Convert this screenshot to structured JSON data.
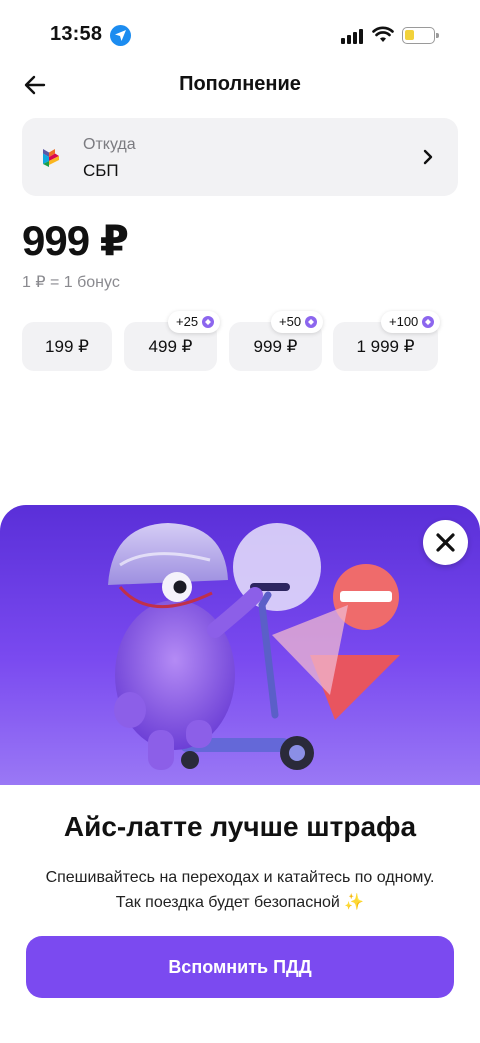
{
  "status_bar": {
    "time": "13:58"
  },
  "header": {
    "title": "Пополнение"
  },
  "source": {
    "label": "Откуда",
    "value": "СБП"
  },
  "amount": "999 ₽",
  "rate": "1 ₽ = 1 бонус",
  "chips": [
    {
      "amount": "199 ₽",
      "bonus": ""
    },
    {
      "amount": "499 ₽",
      "bonus": "+25"
    },
    {
      "amount": "999 ₽",
      "bonus": "+50"
    },
    {
      "amount": "1 999 ₽",
      "bonus": "+100"
    }
  ],
  "promo": {
    "title": "Айс-латте лучше штрафа",
    "line1": "Спешивайтесь на переходах и катайтесь по одному.",
    "line2": "Так поездка будет безопасной ✨",
    "button": "Вспомнить ПДД"
  },
  "colors": {
    "accent": "#7b4af0",
    "banner": "#6a3ae8",
    "bonus_dot": "#8c66ee"
  }
}
